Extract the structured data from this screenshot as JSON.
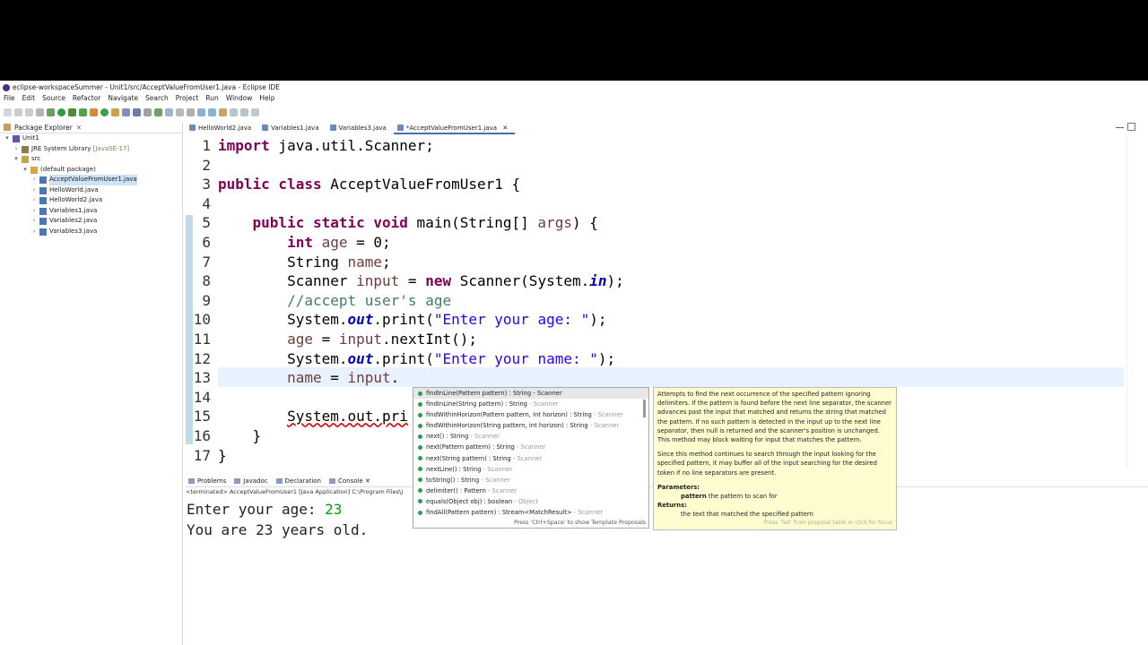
{
  "window": {
    "title": "eclipse-workspaceSummer - Unit1/src/AcceptValueFromUser1.java - Eclipse IDE"
  },
  "menu": [
    "File",
    "Edit",
    "Source",
    "Refactor",
    "Navigate",
    "Search",
    "Project",
    "Run",
    "Window",
    "Help"
  ],
  "package_explorer": {
    "title": "Package Explorer",
    "tree": [
      {
        "label": "Unit1",
        "level": 0,
        "arrow": "▾",
        "icon": "project-icon"
      },
      {
        "label": "JRE System Library",
        "suffix": " [JavaSE-17]",
        "level": 1,
        "arrow": "›",
        "icon": "library-icon"
      },
      {
        "label": "src",
        "level": 1,
        "arrow": "▾",
        "icon": "folder-icon"
      },
      {
        "label": "(default package)",
        "level": 2,
        "arrow": "▾",
        "icon": "package-icon"
      },
      {
        "label": "AcceptValueFromUser1.java",
        "level": 3,
        "arrow": "›",
        "icon": "java-file-icon",
        "selected": true
      },
      {
        "label": "HelloWorld.java",
        "level": 3,
        "arrow": "›",
        "icon": "java-file-icon"
      },
      {
        "label": "HelloWorld2.java",
        "level": 3,
        "arrow": "›",
        "icon": "java-file-icon"
      },
      {
        "label": "Variables1.java",
        "level": 3,
        "arrow": "›",
        "icon": "java-file-icon"
      },
      {
        "label": "Variables2.java",
        "level": 3,
        "arrow": "›",
        "icon": "java-file-icon"
      },
      {
        "label": "Variables3.java",
        "level": 3,
        "arrow": "›",
        "icon": "java-file-icon"
      }
    ]
  },
  "editor_tabs": [
    {
      "label": "HelloWorld2.java"
    },
    {
      "label": "Variables1.java"
    },
    {
      "label": "Variables3.java"
    },
    {
      "label": "*AcceptValueFromUser1.java",
      "active": true
    }
  ],
  "line_numbers": [
    "1",
    "2",
    "3",
    "4",
    "5",
    "6",
    "7",
    "8",
    "9",
    "10",
    "11",
    "12",
    "13",
    "14",
    "15",
    "16",
    "17"
  ],
  "bottom_tabs": [
    {
      "label": "Problems"
    },
    {
      "label": "Javadoc"
    },
    {
      "label": "Declaration"
    },
    {
      "label": "Console",
      "active": true
    }
  ],
  "console": {
    "terminated": "<terminated> AcceptValueFromUser1 [Java Application] C:\\Program Files\\J",
    "line1_prompt": "Enter your age: ",
    "line1_input": "23",
    "line2": "You are 23 years old."
  },
  "proposals": [
    {
      "main": "findInLine(Pattern pattern) : String - Scanner",
      "sec": "",
      "selected": true
    },
    {
      "main": "findInLine(String pattern) : String",
      "sec": " - Scanner"
    },
    {
      "main": "findWithinHorizon(Pattern pattern, int horizon) : String",
      "sec": " - Scanner"
    },
    {
      "main": "findWithinHorizon(String pattern, int horizon) : String",
      "sec": " - Scanner"
    },
    {
      "main": "next() : String",
      "sec": " - Scanner"
    },
    {
      "main": "next(Pattern pattern) : String",
      "sec": " - Scanner"
    },
    {
      "main": "next(String pattern) : String",
      "sec": " - Scanner"
    },
    {
      "main": "nextLine() : String",
      "sec": " - Scanner"
    },
    {
      "main": "toString() : String",
      "sec": " - Scanner"
    },
    {
      "main": "delimiter() : Pattern",
      "sec": " - Scanner"
    },
    {
      "main": "equals(Object obj) : boolean",
      "sec": " - Object"
    },
    {
      "main": "findAll(Pattern pattern) : Stream<MatchResult>",
      "sec": " - Scanner"
    }
  ],
  "proposals_footer": "Press 'Ctrl+Space' to show Template Proposals",
  "doc": {
    "p1": "Attempts to find the next occurrence of the specified pattern ignoring delimiters. If the pattern is found before the next line separator, the scanner advances past the input that matched and returns the string that matched the pattern. If no such pattern is detected in the input up to the next line separator, then null is returned and the scanner's position is unchanged. This method may block waiting for input that matches the pattern.",
    "p2": "Since this method continues to search through the input looking for the specified pattern, it may buffer all of the input searching for the desired token if no line separators are present.",
    "params_head": "Parameters:",
    "param_name": "pattern",
    "param_desc": " the pattern to scan for",
    "returns_head": "Returns:",
    "returns_desc": "the text that matched the specified pattern",
    "footer": "Press 'Tab' from proposal table or click for focus"
  }
}
